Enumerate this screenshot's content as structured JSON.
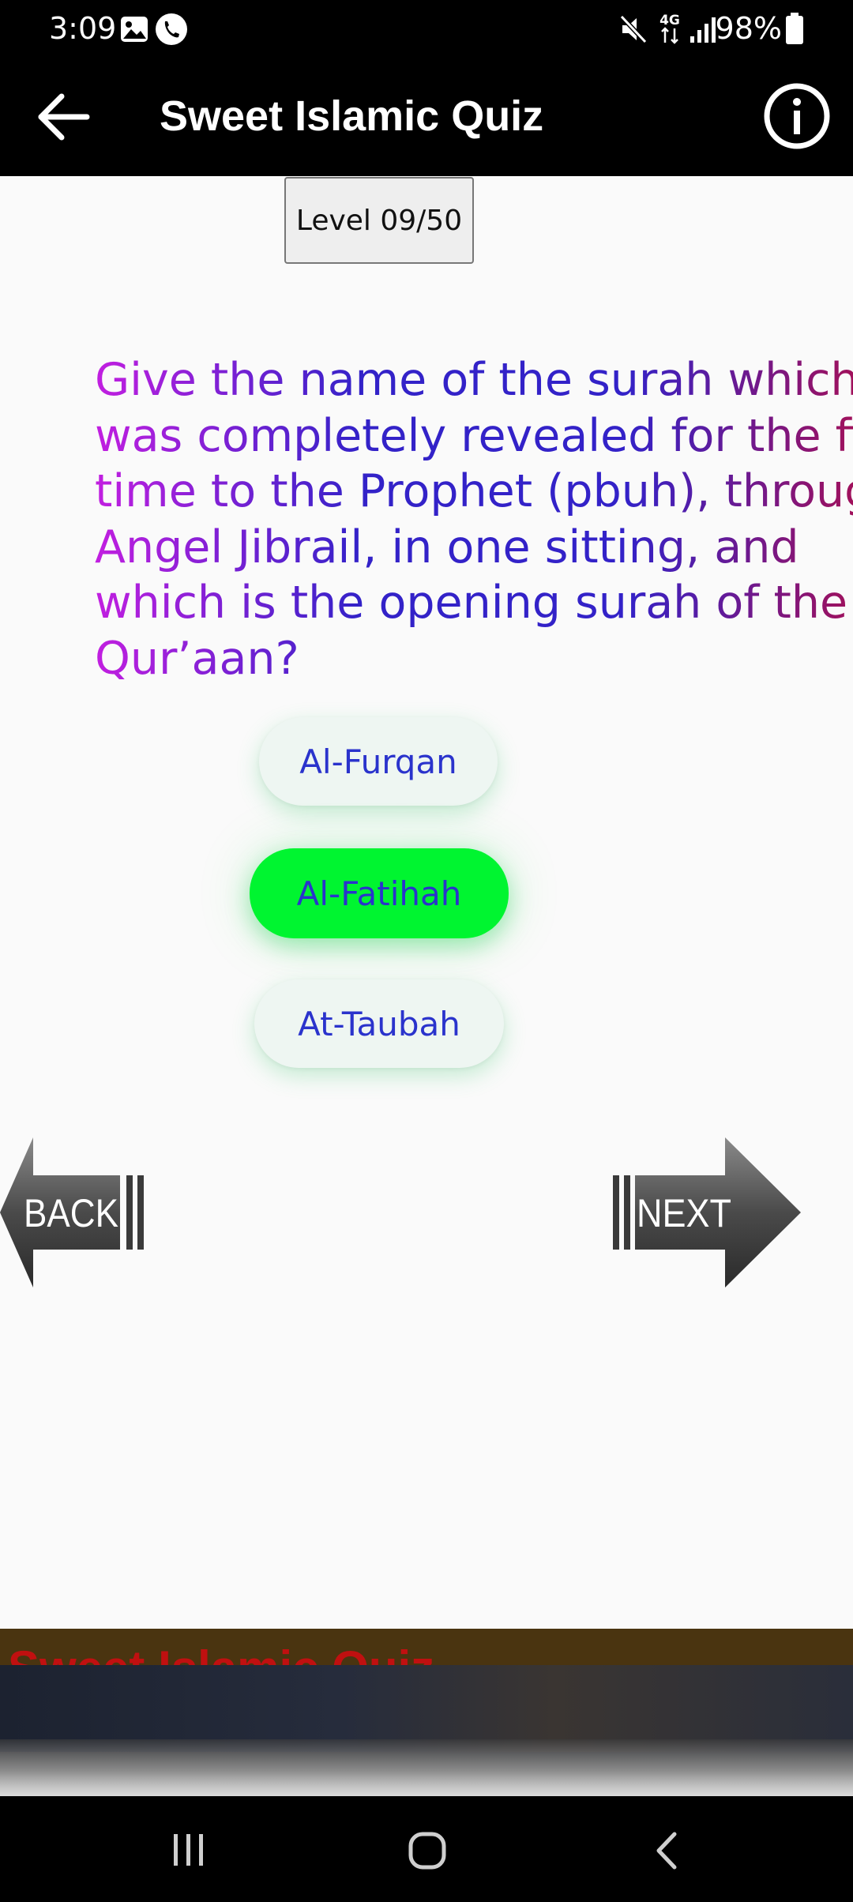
{
  "status_bar": {
    "time": "3:09",
    "battery": "98%",
    "icons": [
      "gallery-icon",
      "phone-call-icon",
      "mute-icon",
      "4g-data-icon",
      "signal-icon",
      "battery-icon"
    ]
  },
  "app_bar": {
    "title": "Sweet Islamic Quiz",
    "back_icon": "arrow-left-icon",
    "info_icon": "info-icon"
  },
  "level": {
    "label": "Level 09/50"
  },
  "question": {
    "lines": [
      "Give the name of the surah which",
      "was completely revealed for the first",
      "time to the Prophet (pbuh), through",
      "Angel Jibrail, in one sitting, and",
      "which is the opening surah of the",
      "Qur’aan?"
    ]
  },
  "options": [
    {
      "label": "Al-Furqan",
      "state": "default"
    },
    {
      "label": "Al-Fatihah",
      "state": "correct"
    },
    {
      "label": "At-Taubah",
      "state": "default"
    }
  ],
  "navigation": {
    "back_label": "BACK",
    "next_label": "NEXT"
  },
  "ad_banner": {
    "partial_text": "Sweet Islamic Quiz"
  },
  "system_nav": {
    "icons": [
      "recent-apps-icon",
      "home-icon",
      "system-back-icon"
    ]
  },
  "colors": {
    "correct_option": "#00f530",
    "option_text": "#2a33cc",
    "question_gradient": [
      "#c21fe0",
      "#3322c8",
      "#a0115c"
    ]
  }
}
